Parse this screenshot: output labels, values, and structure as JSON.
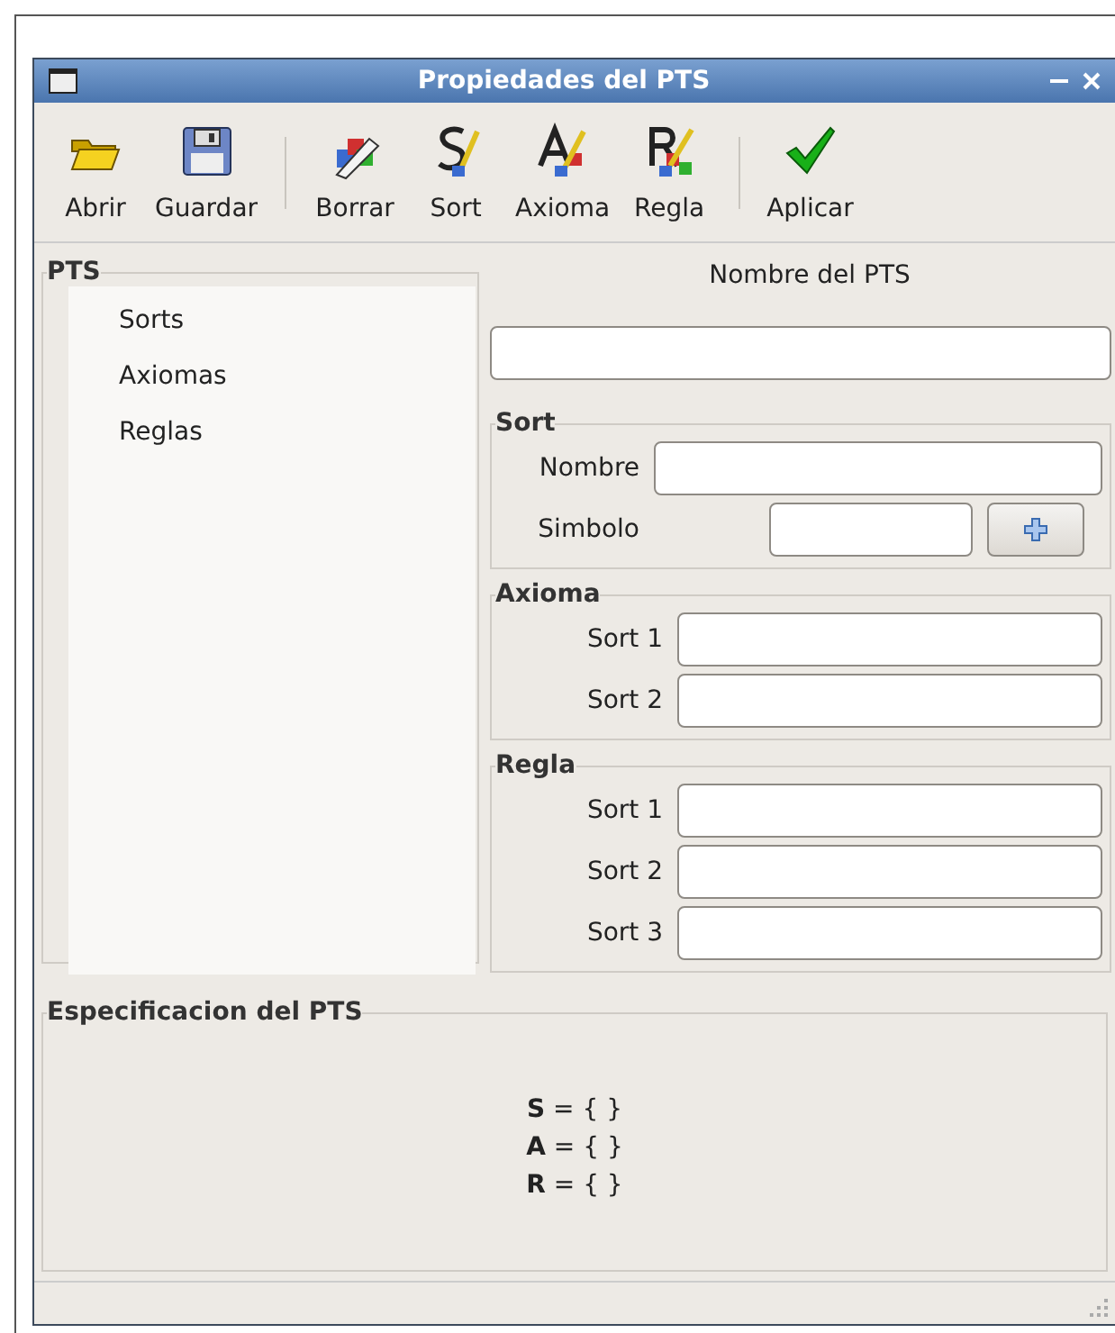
{
  "window": {
    "title": "Propiedades del PTS"
  },
  "toolbar_groups": [
    [
      {
        "label": "Abrir",
        "kind": "open"
      },
      {
        "label": "Guardar",
        "kind": "save"
      }
    ],
    [
      {
        "label": "Borrar",
        "kind": "erase"
      },
      {
        "label": "Sort",
        "kind": "sort"
      },
      {
        "label": "Axioma",
        "kind": "axiom"
      },
      {
        "label": "Regla",
        "kind": "rule"
      }
    ],
    [
      {
        "label": "Aplicar",
        "kind": "apply"
      }
    ]
  ],
  "pts_tree": {
    "title": "PTS",
    "items": [
      "Sorts",
      "Axiomas",
      "Reglas"
    ]
  },
  "name_label": "Nombre del PTS",
  "groups": [
    {
      "title": "Sort",
      "rows": [
        {
          "label": "Nombre",
          "kind": "text"
        },
        {
          "label": "Simbolo",
          "kind": "symbol"
        }
      ]
    },
    {
      "title": "Axioma",
      "rows": [
        {
          "label": "Sort 1",
          "kind": "short"
        },
        {
          "label": "Sort 2",
          "kind": "short"
        }
      ]
    },
    {
      "title": "Regla",
      "rows": [
        {
          "label": "Sort 1",
          "kind": "short"
        },
        {
          "label": "Sort 2",
          "kind": "short"
        },
        {
          "label": "Sort 3",
          "kind": "short"
        }
      ]
    }
  ],
  "specification": {
    "title": "Especificacion del PTS",
    "lines": [
      "**S** = {  }",
      "**A** = {  }",
      "**R** = {  }"
    ]
  }
}
